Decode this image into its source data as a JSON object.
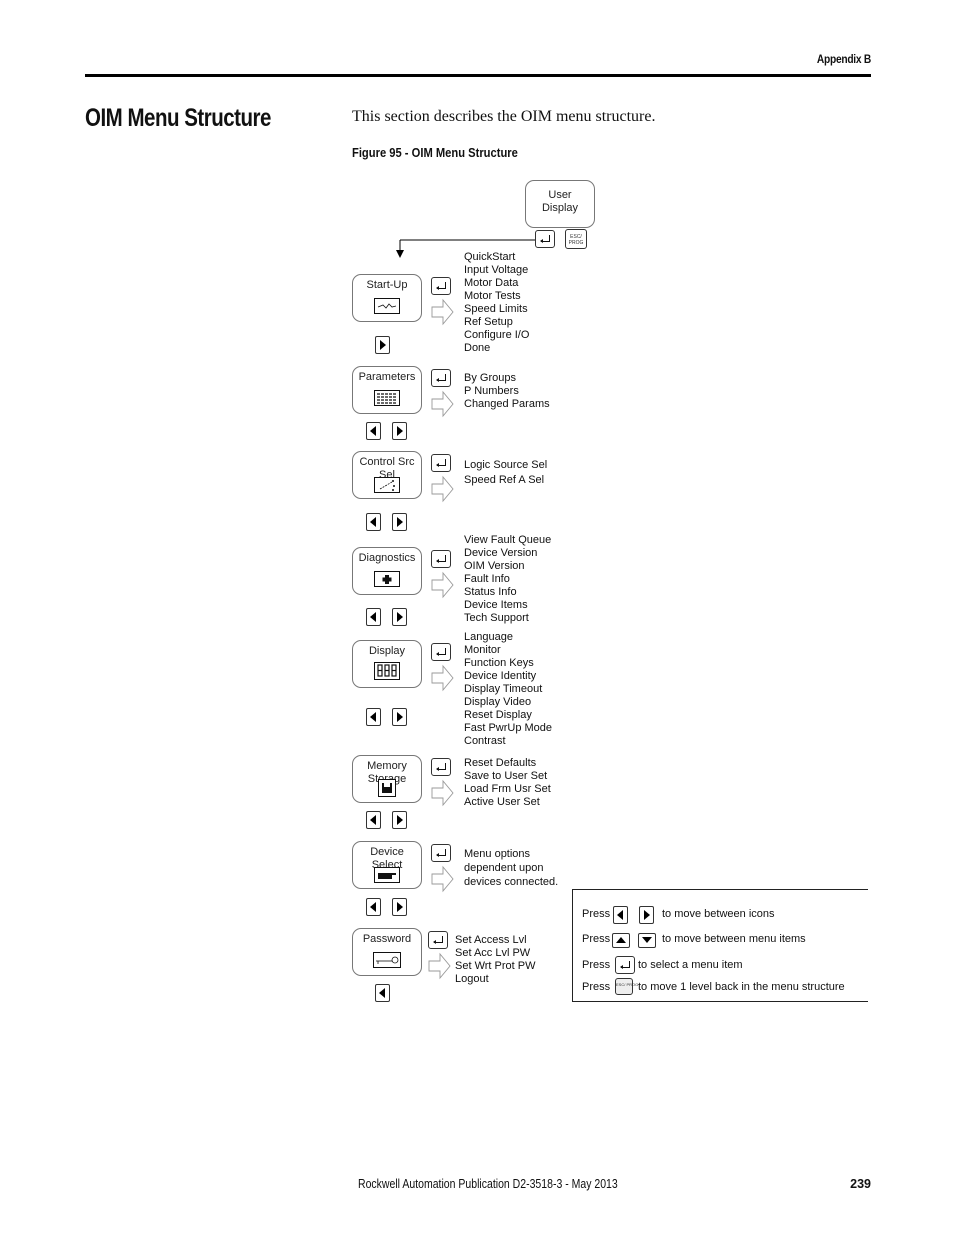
{
  "header": {
    "appendix": "Appendix B"
  },
  "section": {
    "title": "OIM Menu Structure",
    "intro": "This section describes the OIM menu structure.",
    "figure_caption": "Figure 95 - OIM Menu Structure"
  },
  "diagram": {
    "root": {
      "label_line1": "User",
      "label_line2": "Display",
      "esc_key_label": "ESC/ PROG"
    },
    "menus": [
      {
        "label_line1": "Start-Up",
        "label_line2": "",
        "icon": "waveform-icon",
        "items": [
          "QuickStart",
          "Input Voltage",
          "Motor Data",
          "Motor Tests",
          "Speed Limits",
          "Ref Setup",
          "Configure I/O",
          "Done"
        ]
      },
      {
        "label_line1": "Parameters",
        "label_line2": "",
        "icon": "parameter-list-icon",
        "items": [
          "By Groups",
          "P Numbers",
          "Changed Params"
        ]
      },
      {
        "label_line1": "Control Src",
        "label_line2": "Sel",
        "icon": "control-source-icon",
        "items": [
          "Logic Source Sel",
          "Speed Ref A Sel"
        ]
      },
      {
        "label_line1": "Diagnostics",
        "label_line2": "",
        "icon": "first-aid-cross-icon",
        "items": [
          "View Fault Queue",
          "Device Version",
          "OIM Version",
          "Fault Info",
          "Status Info",
          "Device Items",
          "Tech Support"
        ]
      },
      {
        "label_line1": "Display",
        "label_line2": "",
        "icon": "seven-segment-icon",
        "items": [
          "Language",
          "Monitor",
          "Function Keys",
          "Device Identity",
          "Display Timeout",
          "Display Video",
          "Reset Display",
          "Fast PwrUp Mode",
          "Contrast"
        ]
      },
      {
        "label_line1": "Memory",
        "label_line2": "Storage",
        "icon": "floppy-disk-icon",
        "items": [
          "Reset Defaults",
          "Save to User Set",
          "Load Frm Usr Set",
          "Active User Set"
        ]
      },
      {
        "label_line1": "Device",
        "label_line2": "Select",
        "icon": "device-plug-icon",
        "items": [
          "Menu options",
          "dependent upon",
          "devices connected."
        ]
      },
      {
        "label_line1": "Password",
        "label_line2": "",
        "icon": "key-icon",
        "items": [
          "Set Access Lvl",
          "Set Acc Lvl PW",
          "Set Wrt Prot PW",
          "Logout"
        ]
      }
    ],
    "legend": {
      "rows": [
        {
          "press": "Press",
          "text": "to move between icons"
        },
        {
          "press": "Press",
          "text": "to move between menu items"
        },
        {
          "press": "Press",
          "text": "to select a menu item"
        },
        {
          "press": "Press",
          "text": "to move 1 level back in the menu structure"
        }
      ],
      "esc_key_label": "ESC/ PROG"
    }
  },
  "footer": {
    "publication": "Rockwell Automation Publication D2-3518-3 - May 2013",
    "page_number": "239"
  }
}
